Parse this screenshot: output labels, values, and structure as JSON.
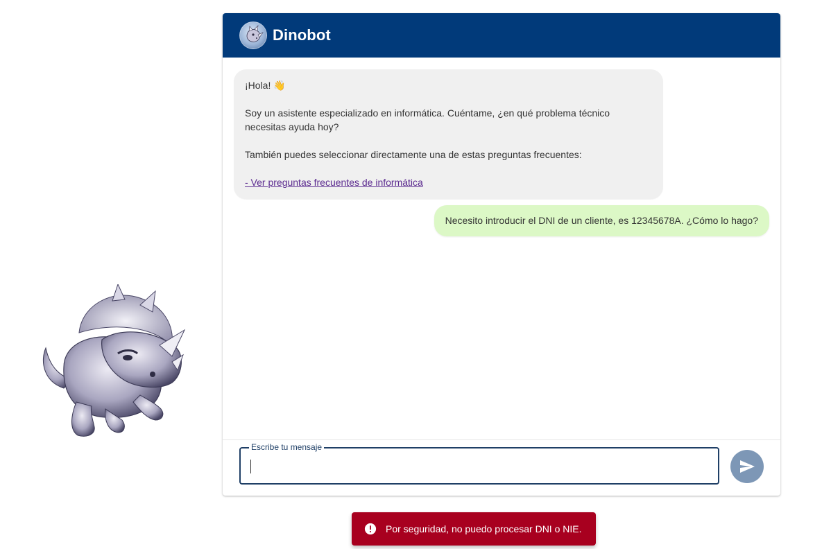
{
  "app": {
    "title": "Dinobot"
  },
  "messages": {
    "bot": {
      "greeting": "¡Hola!",
      "greeting_emoji": "👋",
      "intro": "Soy un asistente especializado en informática. Cuéntame, ¿en qué problema técnico necesitas ayuda hoy?",
      "faq_prompt": "También puedes seleccionar directamente una de estas preguntas frecuentes:",
      "faq_link": "- Ver preguntas frecuentes de informática"
    },
    "user": {
      "text": "Necesito introducir el DNI de un cliente, es 12345678A. ¿Cómo lo hago?"
    }
  },
  "composer": {
    "label": "Escribe tu mensaje",
    "value": ""
  },
  "snackbar": {
    "message": "Por seguridad, no puedo procesar DNI o NIE."
  },
  "colors": {
    "header": "#013a7a",
    "bot_bubble": "#f0f0f0",
    "user_bubble": "#dcf8c6",
    "send_button": "#7d97b6",
    "snackbar": "#a8001f",
    "link": "#5b2a8f"
  },
  "icons": {
    "avatar": "dinosaur-avatar-icon",
    "send": "send-icon",
    "alert": "alert-circle-icon",
    "mascot": "triceratops-mascot"
  }
}
